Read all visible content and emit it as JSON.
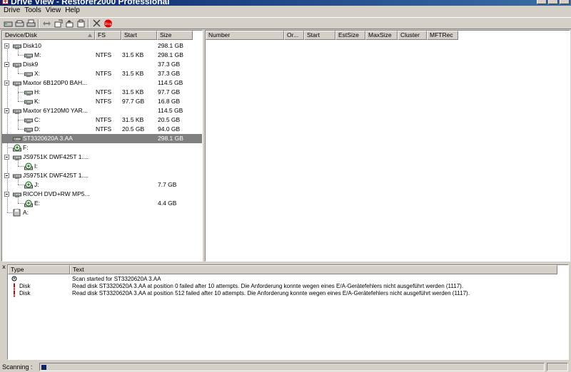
{
  "window": {
    "title": "Drive View - Restorer2000 Professional",
    "icon": "restorer-app-icon"
  },
  "menu": [
    "Drive",
    "Tools",
    "View",
    "Help"
  ],
  "toolbar": {
    "icons": [
      "open-drive-icon",
      "open-image-icon",
      "print-icon",
      "compare-icon",
      "export-icon",
      "folder-up-icon",
      "folder-save-icon",
      "cancel-icon",
      "stop-icon"
    ],
    "stop_label": "Stop"
  },
  "tree": {
    "columns": [
      "Device/Disk",
      "FS",
      "Start",
      "Size"
    ],
    "rows": [
      {
        "level": 0,
        "type": "disk",
        "name": "Disk10",
        "fs": "",
        "start": "",
        "size": "298.1 GB"
      },
      {
        "level": 1,
        "type": "partition",
        "name": "M:",
        "fs": "NTFS",
        "start": "31.5 KB",
        "size": "298.1 GB"
      },
      {
        "level": 0,
        "type": "disk",
        "name": "Disk9",
        "fs": "",
        "start": "",
        "size": "37.3 GB"
      },
      {
        "level": 1,
        "type": "partition",
        "name": "X:",
        "fs": "NTFS",
        "start": "31.5 KB",
        "size": "37.3 GB"
      },
      {
        "level": 0,
        "type": "disk",
        "name": "Maxtor 6B120P0 BAH...",
        "fs": "",
        "start": "",
        "size": "114.5 GB"
      },
      {
        "level": 1,
        "type": "partition",
        "name": "H:",
        "fs": "NTFS",
        "start": "31.5 KB",
        "size": "97.7 GB"
      },
      {
        "level": 1,
        "type": "partition",
        "name": "K:",
        "fs": "NTFS",
        "start": "97.7 GB",
        "size": "16.8 GB"
      },
      {
        "level": 0,
        "type": "disk",
        "name": "Maxtor 6Y120M0 YAR...",
        "fs": "",
        "start": "",
        "size": "114.5 GB"
      },
      {
        "level": 1,
        "type": "partition",
        "name": "C:",
        "fs": "NTFS",
        "start": "31.5 KB",
        "size": "20.5 GB"
      },
      {
        "level": 1,
        "type": "partition",
        "name": "D:",
        "fs": "NTFS",
        "start": "20.5 GB",
        "size": "94.0 GB"
      },
      {
        "level": 0,
        "type": "disk",
        "name": "ST3320620A 3.AA",
        "fs": "",
        "start": "",
        "size": "298.1 GB",
        "selected": true
      },
      {
        "level": 0,
        "type": "cdrom",
        "name": "F:",
        "fs": "",
        "start": "",
        "size": ""
      },
      {
        "level": 0,
        "type": "disk",
        "name": "JS9751K DWF425T 1....",
        "fs": "",
        "start": "",
        "size": ""
      },
      {
        "level": 1,
        "type": "cdrom",
        "name": "I:",
        "fs": "",
        "start": "",
        "size": ""
      },
      {
        "level": 0,
        "type": "disk",
        "name": "JS9751K DWF425T 1....",
        "fs": "",
        "start": "",
        "size": ""
      },
      {
        "level": 1,
        "type": "cdrom",
        "name": "J:",
        "fs": "",
        "start": "",
        "size": "7.7 GB"
      },
      {
        "level": 0,
        "type": "disk",
        "name": "RICOH DVD+RW MP5...",
        "fs": "",
        "start": "",
        "size": ""
      },
      {
        "level": 1,
        "type": "cdrom",
        "name": "E:",
        "fs": "",
        "start": "",
        "size": "4.4 GB"
      },
      {
        "level": 0,
        "type": "floppy",
        "name": "A:",
        "fs": "",
        "start": "",
        "size": ""
      }
    ]
  },
  "details": {
    "columns": [
      "Number",
      "Or...",
      "Start",
      "EstSize",
      "MaxSize",
      "Cluster",
      "MFTRec"
    ]
  },
  "log": {
    "columns": [
      "Type",
      "Text"
    ],
    "close_glyph": "x",
    "rows": [
      {
        "icon": "info-icon",
        "type": "",
        "text": "Scan started for ST3320620A 3.AA"
      },
      {
        "icon": "error-icon",
        "type": "Disk",
        "text": "Read disk ST3320620A 3.AA at position 0 failed after 10 attempts. Die Anforderung konnte wegen eines E/A-Gerätefehlers nicht ausgeführt werden (1117)."
      },
      {
        "icon": "error-icon",
        "type": "Disk",
        "text": "Read disk ST3320620A 3.AA at position 512 failed after 10 attempts. Die Anforderung konnte wegen eines E/A-Gerätefehlers nicht ausgeführt werden (1117)."
      }
    ]
  },
  "status": {
    "label": "Scanning :",
    "progress": 0.01
  },
  "colors": {
    "selection": "#808080",
    "titlebar": "#0a246a",
    "error": "#cc0000"
  }
}
